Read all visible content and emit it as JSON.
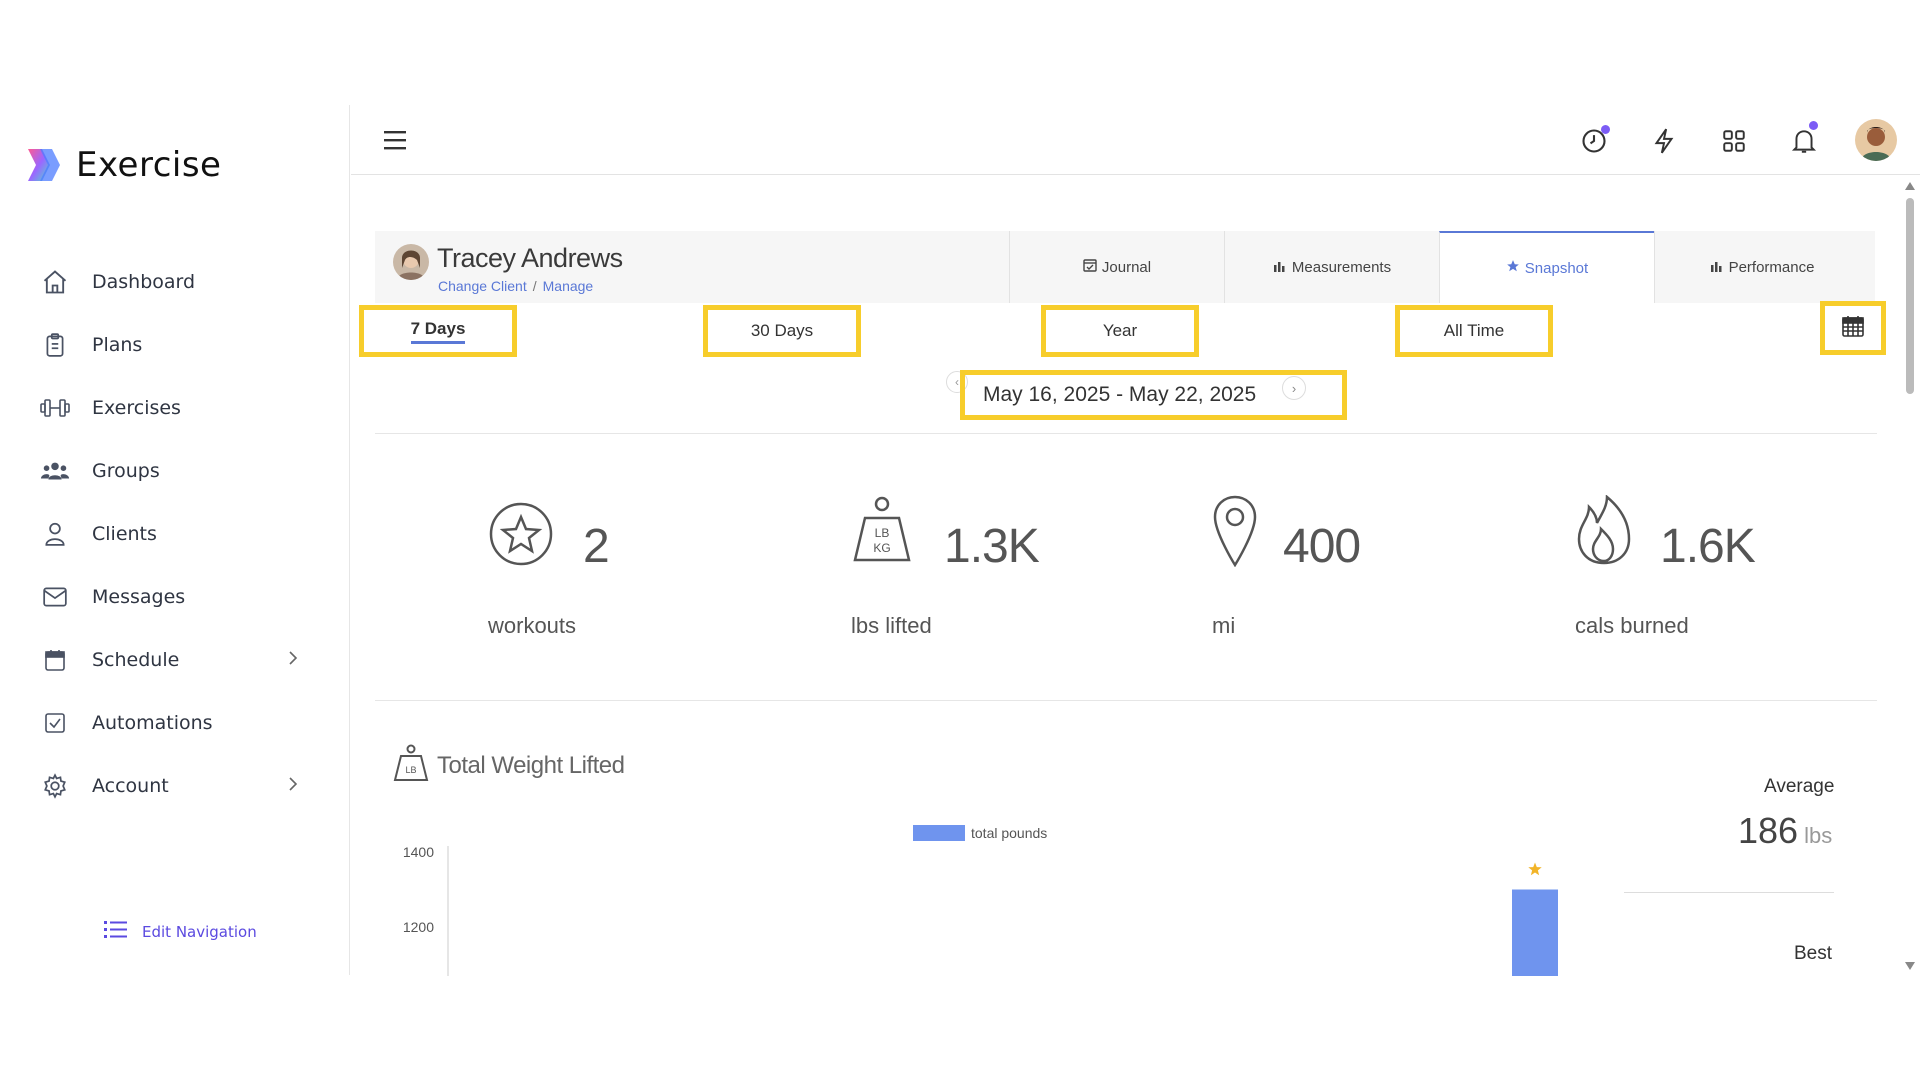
{
  "app": {
    "name": "Exercise"
  },
  "sidebar": {
    "items": [
      {
        "label": "Dashboard",
        "icon": "home-icon"
      },
      {
        "label": "Plans",
        "icon": "clipboard-icon"
      },
      {
        "label": "Exercises",
        "icon": "dumbbell-icon"
      },
      {
        "label": "Groups",
        "icon": "users-icon"
      },
      {
        "label": "Clients",
        "icon": "user-icon"
      },
      {
        "label": "Messages",
        "icon": "envelope-icon"
      },
      {
        "label": "Schedule",
        "icon": "calendar-icon",
        "has_submenu": true
      },
      {
        "label": "Automations",
        "icon": "checkbox-icon"
      },
      {
        "label": "Account",
        "icon": "gear-icon",
        "has_submenu": true
      }
    ],
    "edit_navigation": "Edit Navigation"
  },
  "topbar": {
    "icons": [
      "hamburger-icon",
      "clock-icon",
      "lightning-icon",
      "grid-icon",
      "bell-icon",
      "avatar"
    ]
  },
  "client": {
    "name": "Tracey Andrews",
    "change_client": "Change Client",
    "separator": "/",
    "manage": "Manage"
  },
  "tabs": [
    {
      "label": "Journal",
      "icon": "calendar-check-icon"
    },
    {
      "label": "Measurements",
      "icon": "bar-chart-icon"
    },
    {
      "label": "Snapshot",
      "icon": "star-icon",
      "active": true
    },
    {
      "label": "Performance",
      "icon": "bar-chart-icon"
    }
  ],
  "ranges": [
    {
      "label": "7 Days",
      "active": true
    },
    {
      "label": "30 Days"
    },
    {
      "label": "Year"
    },
    {
      "label": "All Time"
    }
  ],
  "date_range": "May 16, 2025 - May 22, 2025",
  "stats": [
    {
      "value": "2",
      "label": "workouts",
      "icon": "star-circle-icon"
    },
    {
      "value": "1.3K",
      "label": "lbs lifted",
      "icon": "kettlebell-weight-icon"
    },
    {
      "value": "400",
      "label": "mi",
      "icon": "map-pin-icon"
    },
    {
      "value": "1.6K",
      "label": "cals burned",
      "icon": "flame-icon"
    }
  ],
  "weight_section": {
    "title": "Total Weight Lifted",
    "average_label": "Average",
    "average_value": "186",
    "average_unit": "lbs",
    "best_label": "Best"
  },
  "chart_data": {
    "type": "bar",
    "series": [
      {
        "name": "total pounds",
        "values": [
          1300
        ]
      }
    ],
    "y_ticks": [
      "1400",
      "1200"
    ],
    "ylim_visible": [
      1100,
      1400
    ],
    "best_marker": "star",
    "color": "#6f94ee"
  },
  "colors": {
    "accent": "#5a78d6",
    "highlight": "#f7cd2b",
    "notification": "#7c5cf5"
  }
}
